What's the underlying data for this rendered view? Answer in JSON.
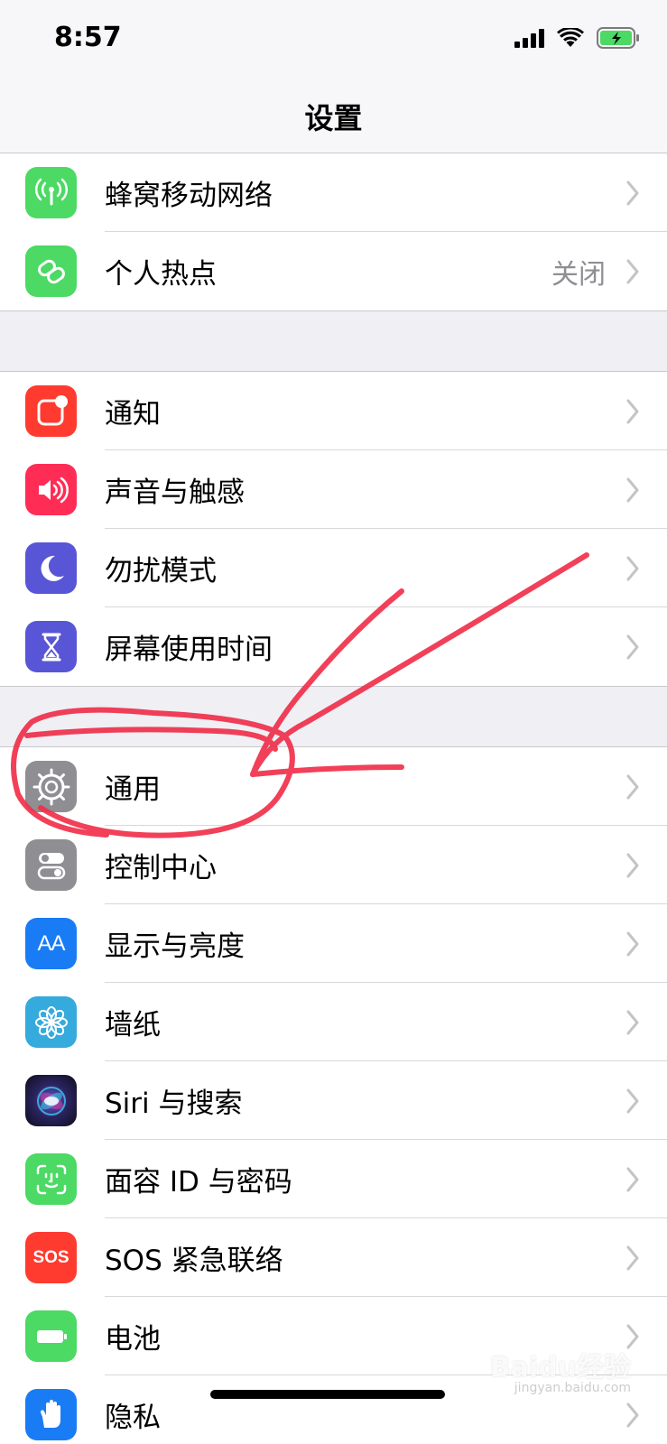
{
  "status": {
    "time": "8:57"
  },
  "nav": {
    "title": "设置"
  },
  "groups": [
    [
      {
        "label": "蜂窝移动网络",
        "icon": "antenna-icon",
        "color": "#4cd964"
      },
      {
        "label": "个人热点",
        "value": "关闭",
        "icon": "hotspot-icon",
        "color": "#4cd964"
      }
    ],
    [
      {
        "label": "通知",
        "icon": "notification-icon",
        "color": "#ff3b30"
      },
      {
        "label": "声音与触感",
        "icon": "speaker-icon",
        "color": "#ff2d55"
      },
      {
        "label": "勿扰模式",
        "icon": "moon-icon",
        "color": "#5856d6"
      },
      {
        "label": "屏幕使用时间",
        "icon": "hourglass-icon",
        "color": "#5856d6"
      }
    ],
    [
      {
        "label": "通用",
        "icon": "gear-icon",
        "color": "#8e8e93"
      },
      {
        "label": "控制中心",
        "icon": "toggles-icon",
        "color": "#8e8e93"
      },
      {
        "label": "显示与亮度",
        "icon": "text-size-icon",
        "color": "#1a7cf5"
      },
      {
        "label": "墙纸",
        "icon": "flower-icon",
        "color": "#35aadc"
      },
      {
        "label": "Siri 与搜索",
        "icon": "siri-icon",
        "color": "#1c1c3a"
      },
      {
        "label": "面容 ID 与密码",
        "icon": "face-id-icon",
        "color": "#4cd964"
      },
      {
        "label": "SOS 紧急联络",
        "icon": "sos-icon",
        "color": "#ff3b30"
      },
      {
        "label": "电池",
        "icon": "battery-icon",
        "color": "#4cd964"
      },
      {
        "label": "隐私",
        "icon": "hand-icon",
        "color": "#1a7cf5"
      }
    ]
  ],
  "icon_text": {
    "text_size": "AA",
    "sos": "SOS"
  },
  "watermark": {
    "main": "Baidu经验",
    "sub": "jingyan.baidu.com"
  }
}
